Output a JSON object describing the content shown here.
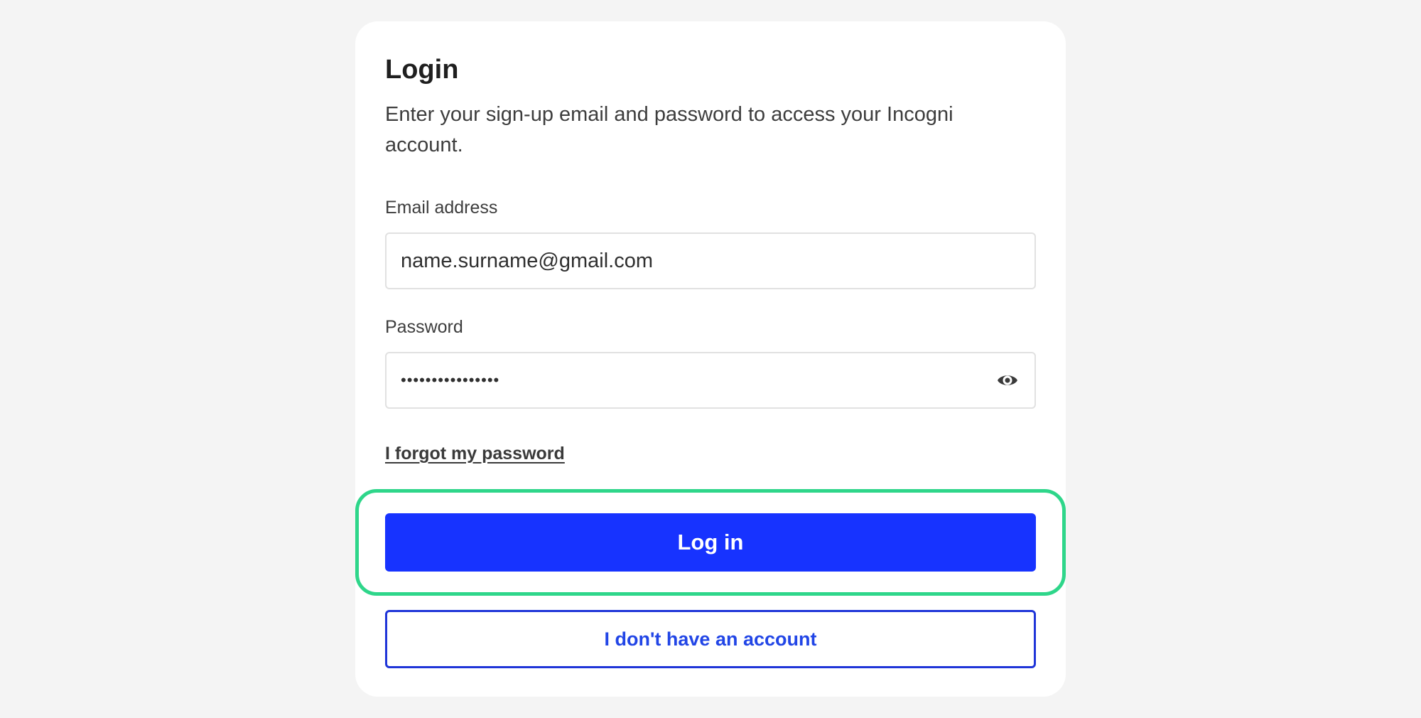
{
  "login": {
    "title": "Login",
    "subtitle": "Enter your sign-up email and password to access your Incogni account.",
    "email_label": "Email address",
    "email_value": "name.surname@gmail.com",
    "password_label": "Password",
    "password_value": "••••••••••••••••",
    "forgot_link": "I forgot my password",
    "login_button": "Log in",
    "no_account_button": "I don't have an account"
  },
  "icons": {
    "password_toggle": "eye-icon"
  },
  "colors": {
    "primary": "#1733ff",
    "highlight": "#2ed68a",
    "secondary_border": "#1f35d8",
    "background": "#f4f4f4"
  }
}
